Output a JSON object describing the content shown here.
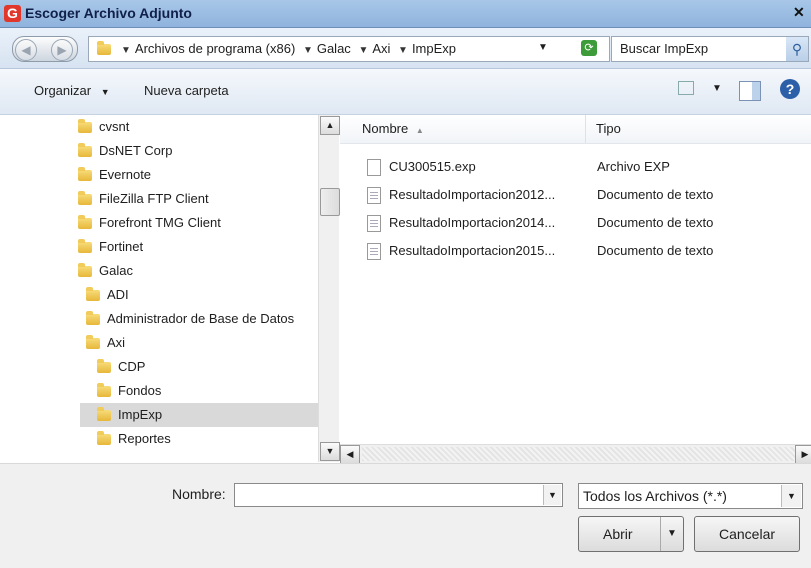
{
  "window": {
    "title": "Escoger Archivo Adjunto",
    "close_glyph": "✕",
    "app_icon_letter": "G"
  },
  "address_bar": {
    "crumbs": [
      "Archivos de programa (x86)",
      "Galac",
      "Axi",
      "ImpExp"
    ],
    "search_placeholder": "Buscar ImpExp"
  },
  "toolbar": {
    "organize": "Organizar",
    "new_folder": "Nueva carpeta",
    "help_glyph": "?"
  },
  "tree": {
    "items": [
      {
        "label": "cvsnt",
        "indent": 0,
        "selected": false
      },
      {
        "label": "DsNET Corp",
        "indent": 0,
        "selected": false
      },
      {
        "label": "Evernote",
        "indent": 0,
        "selected": false
      },
      {
        "label": "FileZilla FTP Client",
        "indent": 0,
        "selected": false
      },
      {
        "label": "Forefront TMG Client",
        "indent": 0,
        "selected": false
      },
      {
        "label": "Fortinet",
        "indent": 0,
        "selected": false
      },
      {
        "label": "Galac",
        "indent": 0,
        "selected": false
      },
      {
        "label": "ADI",
        "indent": 1,
        "selected": false
      },
      {
        "label": "Administrador de Base de Datos",
        "indent": 1,
        "selected": false
      },
      {
        "label": "Axi",
        "indent": 1,
        "selected": false
      },
      {
        "label": "CDP",
        "indent": 2,
        "selected": false
      },
      {
        "label": "Fondos",
        "indent": 2,
        "selected": false
      },
      {
        "label": "ImpExp",
        "indent": 2,
        "selected": true
      },
      {
        "label": "Reportes",
        "indent": 2,
        "selected": false
      }
    ]
  },
  "file_list": {
    "columns": {
      "name": "Nombre",
      "type": "Tipo"
    },
    "files": [
      {
        "name": "CU300515.exp",
        "type": "Archivo EXP",
        "icon": "blank"
      },
      {
        "name": "ResultadoImportacion2012...",
        "type": "Documento de texto",
        "icon": "txt"
      },
      {
        "name": "ResultadoImportacion2014...",
        "type": "Documento de texto",
        "icon": "txt"
      },
      {
        "name": "ResultadoImportacion2015...",
        "type": "Documento de texto",
        "icon": "txt"
      }
    ]
  },
  "footer": {
    "name_label": "Nombre:",
    "name_value": "",
    "filter": "Todos los Archivos (*.*)",
    "open": "Abrir",
    "cancel": "Cancelar"
  }
}
